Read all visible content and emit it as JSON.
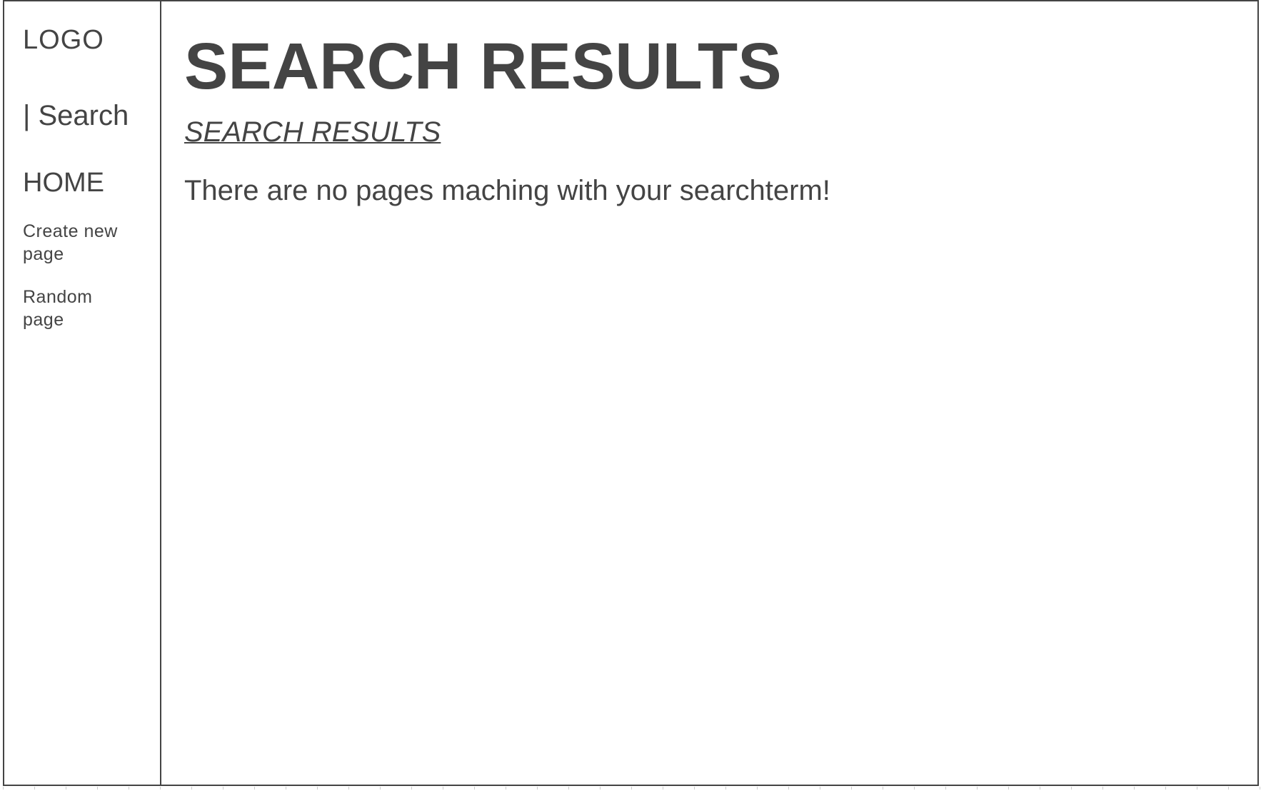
{
  "sidebar": {
    "logo": "LOGO",
    "search_label": "| Search",
    "home_label": "HOME",
    "create_page_label": "Create new page",
    "random_page_label": "Random page"
  },
  "main": {
    "title": "SEARCH RESULTS",
    "subtitle": "SEARCH RESULTS",
    "message": "There are no pages maching with your searchterm!"
  },
  "colors": {
    "text": "#444444",
    "border": "#444444",
    "background": "#ffffff"
  }
}
